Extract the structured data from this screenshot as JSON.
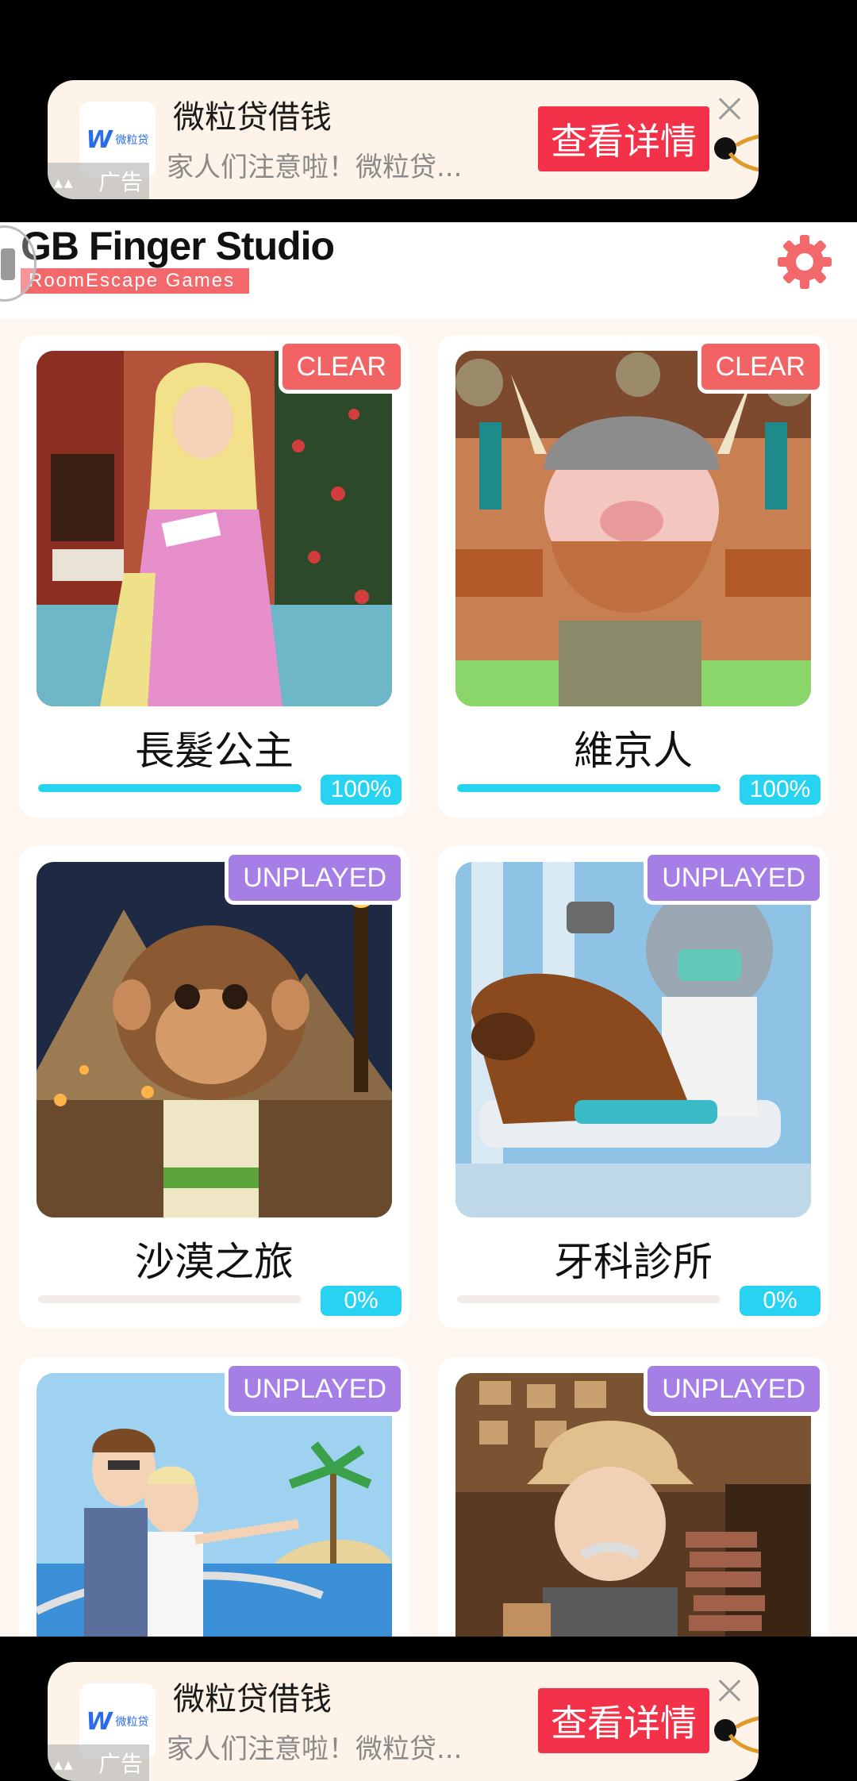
{
  "ads": [
    {
      "position": "top",
      "logo_letter": "W",
      "logo_brand": "微粒贷",
      "title": "微粒贷借钱",
      "description": "家人们注意啦！微粒贷...",
      "cta": "查看详情",
      "ad_label": "广告"
    },
    {
      "position": "bottom",
      "logo_letter": "W",
      "logo_brand": "微粒贷",
      "title": "微粒贷借钱",
      "description": "家人们注意啦！微粒贷...",
      "cta": "查看详情",
      "ad_label": "广告"
    }
  ],
  "header": {
    "title": "GB Finger Studio",
    "subtitle": "RoomEscape  Games",
    "settings_icon": "gear-icon",
    "settings_color": "#f2686b"
  },
  "games": [
    {
      "name": "長髮公主",
      "status": "CLEAR",
      "progress_label": "100%",
      "progress": 1.0,
      "art": "princess"
    },
    {
      "name": "維京人",
      "status": "CLEAR",
      "progress_label": "100%",
      "progress": 1.0,
      "art": "viking"
    },
    {
      "name": "沙漠之旅",
      "status": "UNPLAYED",
      "progress_label": "0%",
      "progress": 0.0,
      "art": "desert"
    },
    {
      "name": "牙科診所",
      "status": "UNPLAYED",
      "progress_label": "0%",
      "progress": 0.0,
      "art": "dentist"
    },
    {
      "name": "",
      "status": "UNPLAYED",
      "progress_label": "",
      "progress": 0.0,
      "art": "cruise"
    },
    {
      "name": "",
      "status": "UNPLAYED",
      "progress_label": "",
      "progress": 0.0,
      "art": "detective"
    }
  ],
  "colors": {
    "clear_badge": "#f26364",
    "unplayed_badge": "#a57ee6",
    "progress": "#28d3f2",
    "ad_cta": "#f3324a"
  }
}
